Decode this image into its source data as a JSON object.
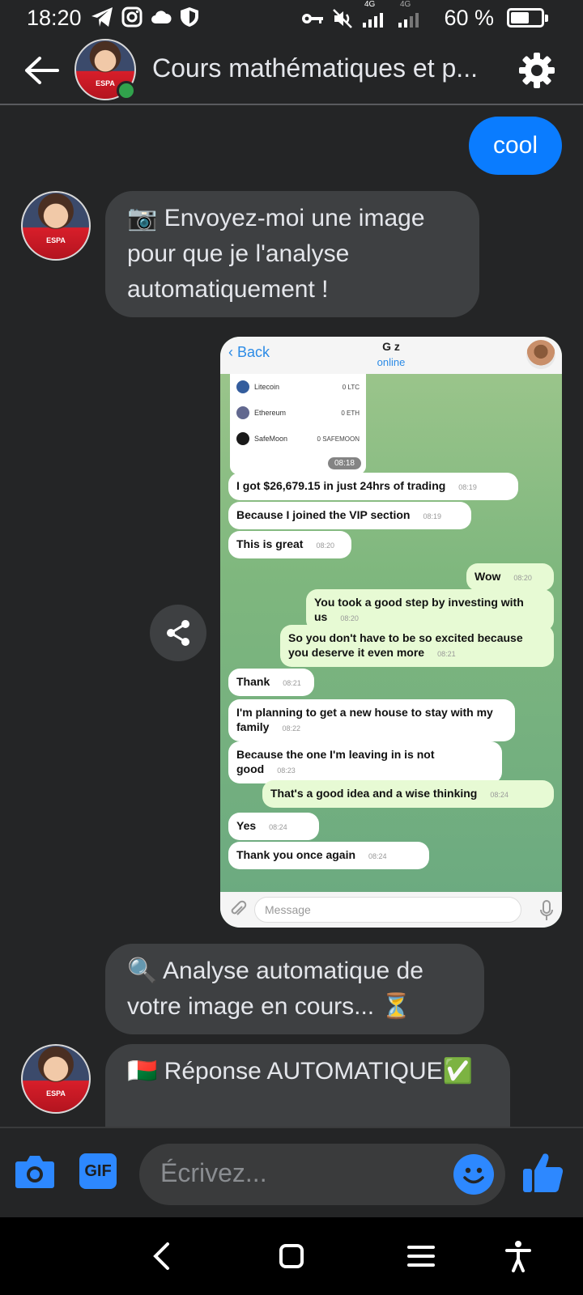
{
  "status_bar": {
    "time": "18:20",
    "left_icons": [
      "telegram-icon",
      "instagram-icon",
      "cloud-icon",
      "shield-icon"
    ],
    "right_icons": [
      "key-icon",
      "mute-icon",
      "signal-4g-icon",
      "signal-4g-icon"
    ],
    "network_labels": [
      "4G",
      "4G"
    ],
    "battery_percent": "60 %",
    "battery_level": 0.6
  },
  "header": {
    "title": "Cours mathématiques et p...",
    "avatar_label": "ESPA"
  },
  "messages": {
    "m1": {
      "text": "cool"
    },
    "m2": {
      "text": "📷 Envoyez-moi une image pour que je l'analyse automatiquement !"
    },
    "m4": {
      "text": "🔍 Analyse automatique de votre image en cours... ⏳"
    },
    "m5": {
      "text": "🇲🇬 Réponse AUTOMATIQUE✅"
    }
  },
  "screenshot_image": {
    "back_label": "Back",
    "contact": "G        z",
    "status": "online",
    "wallet_rows": [
      {
        "name": "Litecoin",
        "value": "0 LTC"
      },
      {
        "name": "Ethereum",
        "value": "0 ETH"
      },
      {
        "name": "SafeMoon",
        "value": "0 SAFEMOON"
      }
    ],
    "wallet_time": "08:18",
    "chat": [
      {
        "text": "I got $26,679.15 in just 24hrs of trading",
        "time": "08:19",
        "dir": "in"
      },
      {
        "text": "Because I joined the VIP section",
        "time": "08:19",
        "dir": "in"
      },
      {
        "text": "This is great",
        "time": "08:20",
        "dir": "in"
      },
      {
        "text": "Wow",
        "time": "08:20",
        "dir": "out"
      },
      {
        "text": "You took a good step by investing with us",
        "time": "08:20",
        "dir": "out"
      },
      {
        "text": "So you don't have to be so excited because you deserve it even more",
        "time": "08:21",
        "dir": "out"
      },
      {
        "text": "Thank",
        "time": "08:21",
        "dir": "in"
      },
      {
        "text": "I'm planning to get a new house to stay with my family",
        "time": "08:22",
        "dir": "in"
      },
      {
        "text": "Because the one I'm leaving in is not good",
        "time": "08:23",
        "dir": "in"
      },
      {
        "text": "That's a good idea and a wise thinking",
        "time": "08:24",
        "dir": "out"
      },
      {
        "text": "Yes",
        "time": "08:24",
        "dir": "in"
      },
      {
        "text": "Thank you once again",
        "time": "08:24",
        "dir": "in"
      }
    ],
    "compose_placeholder": "Message"
  },
  "composer": {
    "gif_label": "GIF",
    "placeholder": "Écrivez..."
  },
  "colors": {
    "background": "#242526",
    "bubble_out": "#0a7cff",
    "bubble_in": "#3e4042",
    "accent": "#2d88ff",
    "online": "#31a24c"
  }
}
